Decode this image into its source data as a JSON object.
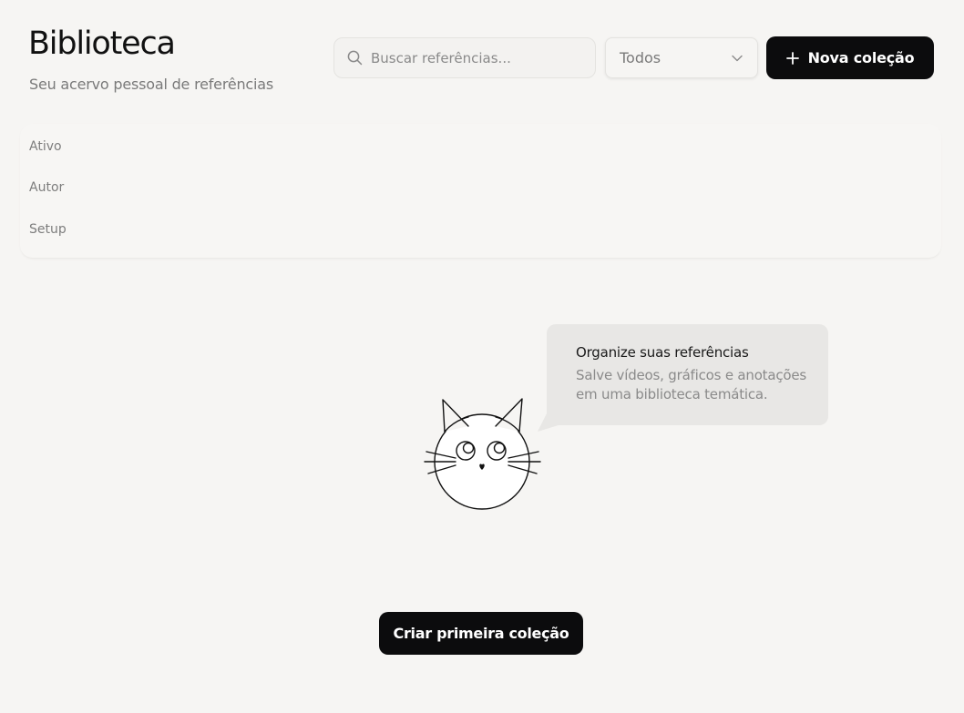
{
  "header": {
    "title": "Biblioteca",
    "subtitle": "Seu acervo pessoal de referências"
  },
  "search": {
    "placeholder": "Buscar referências...",
    "value": "",
    "icon": "search-icon"
  },
  "filter": {
    "selected": "Todos",
    "icon": "chevron-down-icon"
  },
  "toolbar": {
    "new_collection_label": "Nova coleção",
    "new_collection_icon": "plus-icon"
  },
  "meta": {
    "rows": [
      "Ativo",
      "Autor",
      "Setup"
    ]
  },
  "empty_state": {
    "bubble_title": "Organize suas referências",
    "bubble_line1": "Salve vídeos, gráficos e anotações",
    "bubble_line2": "em uma biblioteca temática.",
    "illustration": "cat-illustration",
    "cta_label": "Criar primeira coleção"
  },
  "colors": {
    "background": "#f6f5f3",
    "primary_button": "#0c0c0d",
    "bubble": "#e8e7e5",
    "muted_text": "#7a7a7a"
  }
}
